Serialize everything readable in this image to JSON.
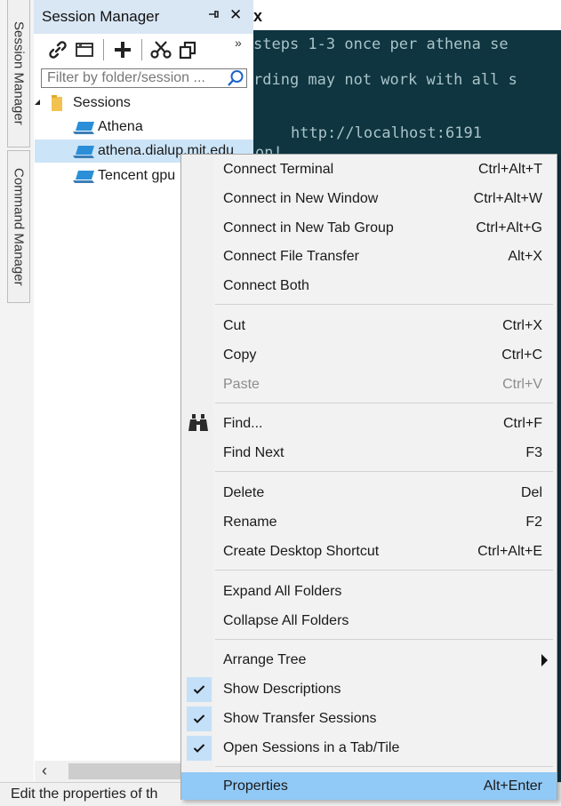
{
  "dock_tabs": {
    "session_manager": "Session Manager",
    "command_manager": "Command Manager"
  },
  "panel": {
    "title": "Session Manager",
    "pin_icon": "pin-icon",
    "close_icon": "close-icon",
    "more": "»",
    "filter_placeholder": "Filter by folder/session ..."
  },
  "tree": {
    "root": "Sessions",
    "items": [
      "Athena",
      "athena.dialup.mit.edu",
      "Tencent gpu"
    ]
  },
  "terminal": {
    "tab_close": "x",
    "lines": [
      "steps 1-3 once per athena se",
      "rding may not work with all s",
      "http://localhost:6191",
      "on!"
    ]
  },
  "context_menu": {
    "items": [
      {
        "label": "Connect Terminal",
        "shortcut": "Ctrl+Alt+T"
      },
      {
        "label": "Connect in New Window",
        "shortcut": "Ctrl+Alt+W"
      },
      {
        "label": "Connect in New Tab Group",
        "shortcut": "Ctrl+Alt+G"
      },
      {
        "label": "Connect File Transfer",
        "shortcut": "Alt+X"
      },
      {
        "label": "Connect Both",
        "shortcut": ""
      },
      {
        "label": "Cut",
        "shortcut": "Ctrl+X"
      },
      {
        "label": "Copy",
        "shortcut": "Ctrl+C"
      },
      {
        "label": "Paste",
        "shortcut": "Ctrl+V"
      },
      {
        "label": "Find...",
        "shortcut": "Ctrl+F"
      },
      {
        "label": "Find Next",
        "shortcut": "F3"
      },
      {
        "label": "Delete",
        "shortcut": "Del"
      },
      {
        "label": "Rename",
        "shortcut": "F2"
      },
      {
        "label": "Create Desktop Shortcut",
        "shortcut": "Ctrl+Alt+E"
      },
      {
        "label": "Expand All Folders",
        "shortcut": ""
      },
      {
        "label": "Collapse All Folders",
        "shortcut": ""
      },
      {
        "label": "Arrange Tree",
        "shortcut": ""
      },
      {
        "label": "Show Descriptions",
        "shortcut": ""
      },
      {
        "label": "Show Transfer Sessions",
        "shortcut": ""
      },
      {
        "label": "Open Sessions in a Tab/Tile",
        "shortcut": ""
      },
      {
        "label": "Properties",
        "shortcut": "Alt+Enter"
      }
    ]
  },
  "status_bar": {
    "text": "Edit the properties of th"
  },
  "colors": {
    "title_bar": "#d9e6f4",
    "selection": "#cce4f7",
    "menu_highlight": "#91c9f7",
    "terminal_bg": "#0e3540",
    "terminal_text": "#aac3c8"
  }
}
